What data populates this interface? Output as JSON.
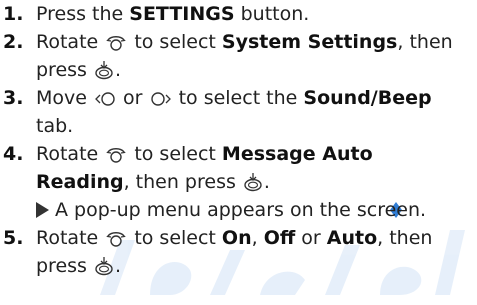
{
  "steps": [
    {
      "number": "1.",
      "text": [
        "Press the ",
        "SETTINGS",
        " button."
      ]
    },
    {
      "number": "2.",
      "line1": [
        "Rotate",
        "to select ",
        "System Settings",
        ", then"
      ],
      "line2": [
        "press",
        "."
      ]
    },
    {
      "number": "3.",
      "line1": [
        "Move",
        "or",
        "to select the ",
        "Sound/Beep"
      ],
      "line2": [
        "tab."
      ]
    },
    {
      "number": "4.",
      "line1": [
        "Rotate",
        "to select ",
        "Message Auto"
      ],
      "line2": [
        "Reading",
        ", then press",
        "."
      ],
      "note": "A pop-up menu appears on the screen."
    },
    {
      "number": "5.",
      "line1": [
        "Rotate",
        "to select ",
        "On",
        ", ",
        "Off",
        " or ",
        "Auto",
        ", then"
      ],
      "line2": [
        "press",
        "."
      ]
    }
  ],
  "icons": {
    "dial": "rotary-dial-icon",
    "press": "enter-press-icon",
    "left": "move-left-icon",
    "right": "move-right-icon"
  },
  "watermark": {
    "color": "#1a6fd0"
  }
}
